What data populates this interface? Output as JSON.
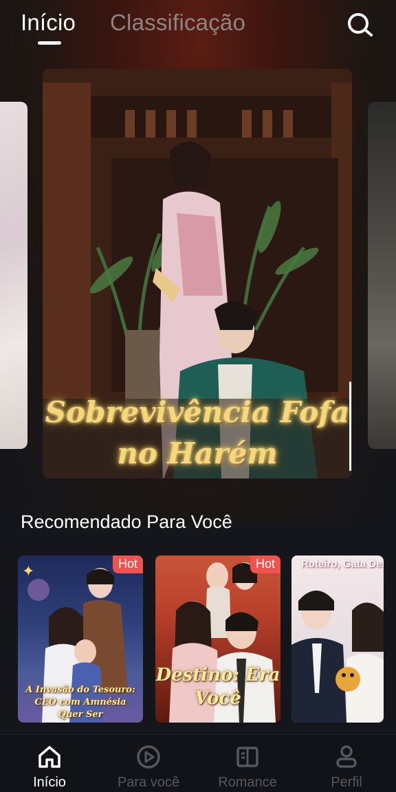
{
  "header": {
    "tabs": [
      {
        "label": "Início",
        "active": true
      },
      {
        "label": "Classificação",
        "active": false
      }
    ],
    "search_icon": "search-icon"
  },
  "carousel": {
    "main_title_line1": "Sobrevivência Fofa",
    "main_title_line2": "no Harém"
  },
  "recommended": {
    "title": "Recomendado Para Você",
    "items": [
      {
        "badge": "Hot",
        "caption": "A Invasão do Tesouro: CEO com Amnésia Quer Ser"
      },
      {
        "badge": "Hot",
        "caption": "Destino: Era Você"
      },
      {
        "badge": "",
        "caption": "Roteiro, Gata Den"
      }
    ]
  },
  "bottom_nav": {
    "items": [
      {
        "label": "Início",
        "icon": "home-icon",
        "active": true
      },
      {
        "label": "Para você",
        "icon": "play-circle-icon",
        "active": false
      },
      {
        "label": "Romance",
        "icon": "book-icon",
        "active": false
      },
      {
        "label": "Perfil",
        "icon": "person-icon",
        "active": false
      }
    ]
  },
  "colors": {
    "background": "#14161c",
    "accent_hot": "#ef5350",
    "nav_active": "#ffffff",
    "nav_inactive": "#55585f",
    "title_gold": "#f6d77a"
  }
}
